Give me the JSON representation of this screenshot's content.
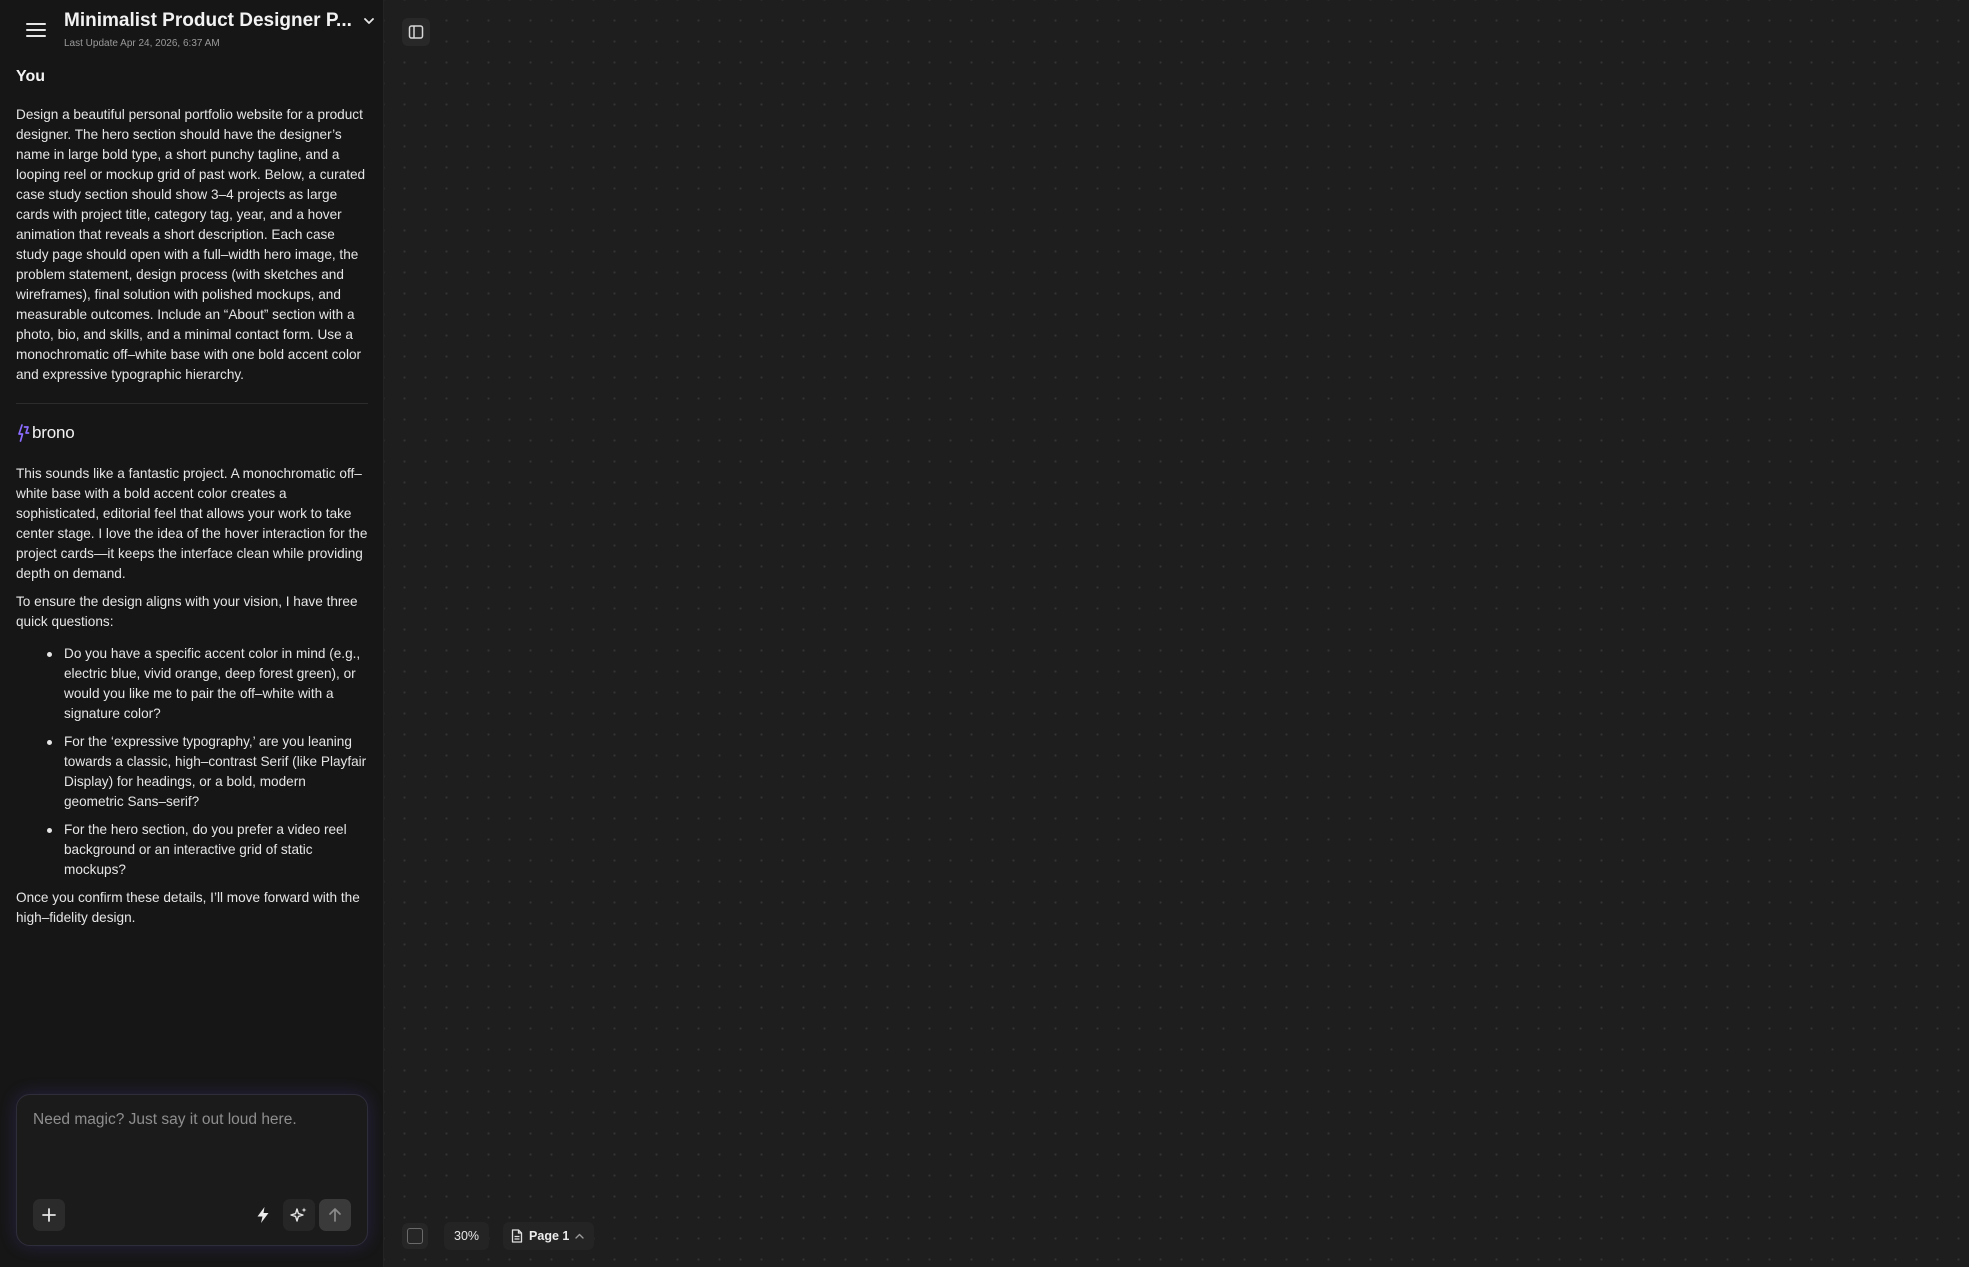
{
  "header": {
    "title": "Minimalist Product Designer P...",
    "last_update": "Last Update Apr 24, 2026, 6:37 AM"
  },
  "chat": {
    "user": {
      "speaker": "You",
      "message": "Design a beautiful personal portfolio website for a product designer. The hero section should have the designer’s name in large bold type, a short punchy tagline, and a looping reel or mockup grid of past work. Below, a curated case study section should show 3–4 projects as large cards with project title, category tag, year, and a hover animation that reveals a short description. Each case study page should open with a full–width hero image, the problem statement, design process (with sketches and wireframes), final solution with polished mockups, and measurable outcomes. Include an “About” section with a photo, bio, and skills, and a minimal contact form. Use a monochromatic off–white base with one bold accent color and expressive typographic hierarchy."
    },
    "assistant": {
      "brand": "brono",
      "intro": "This sounds like a fantastic project. A monochromatic off–white base with a bold accent color creates a sophisticated, editorial feel that allows your work to take center stage. I love the idea of the hover interaction for the project cards—it keeps the interface clean while providing depth on demand.",
      "lead": "To ensure the design aligns with your vision, I have three quick questions:",
      "questions": [
        "Do you have a specific accent color in mind (e.g., electric blue, vivid orange, deep forest green), or would you like me to pair the off–white with a signature color?",
        "For the ‘expressive typography,’ are you leaning towards a classic, high–contrast Serif (like Playfair Display) for headings, or a bold, modern geometric Sans–serif?",
        "For the hero section, do you prefer a video reel background or an interactive grid of static mockups?"
      ],
      "closing": "Once you confirm these details, I’ll move forward with the high–fidelity design."
    }
  },
  "composer": {
    "placeholder": "Need magic? Just say it out loud here."
  },
  "canvas": {
    "zoom": "30%",
    "page": "Page 1"
  },
  "icons": {
    "menu": "hamburger-icon",
    "title_dropdown": "chevron-down-icon",
    "panel_toggle": "sidebar-panel-icon",
    "add": "plus-icon",
    "bolt": "lightning-icon",
    "magic": "sparkle-icon",
    "send": "arrow-up-icon",
    "page": "document-icon",
    "page_dropdown": "chevron-up-icon"
  },
  "colors": {
    "sidebar_bg": "#161616",
    "canvas_bg": "#1e1e1e",
    "brand_accent": "#8b6cff",
    "text": "#e6e6e6"
  }
}
